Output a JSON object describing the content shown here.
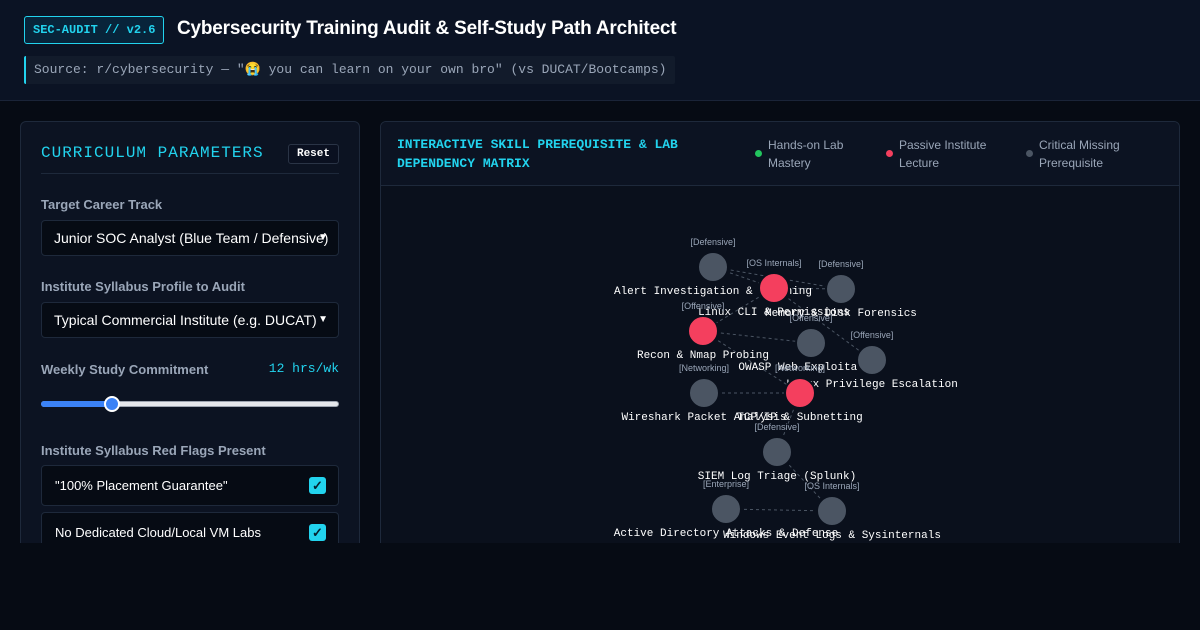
{
  "header": {
    "badge": "SEC-AUDIT // v2.6",
    "title": "Cybersecurity Training Audit & Self-Study Path Architect",
    "source": "Source: r/cybersecurity — \"😭 you can learn on your own bro\" (vs DUCAT/Bootcamps)"
  },
  "params": {
    "title": "CURRICULUM PARAMETERS",
    "reset_label": "Reset",
    "career_label": "Target Career Track",
    "career_value": "Junior SOC Analyst (Blue Team / Defensive)",
    "syllabus_label": "Institute Syllabus Profile to Audit",
    "syllabus_value": "Typical Commercial Institute (e.g. DUCAT)",
    "commitment_label": "Weekly Study Commitment",
    "commitment_value": "12 hrs/wk",
    "commitment_hours": 12,
    "commitment_min": 1,
    "commitment_max": 50,
    "redflags_label": "Institute Syllabus Red Flags Present",
    "flags": [
      {
        "label": "\"100% Placement Guarantee\"",
        "checked": true
      },
      {
        "label": "No Dedicated Cloud/Local VM Labs",
        "checked": true
      }
    ]
  },
  "graph": {
    "title": "INTERACTIVE SKILL PREREQUISITE & LAB DEPENDENCY MATRIX",
    "legend": [
      {
        "label": "Hands-on Lab Mastery",
        "color": "#22c55e"
      },
      {
        "label": "Passive Institute Lecture",
        "color": "#f43f5e"
      },
      {
        "label": "Critical Missing Prerequisite",
        "color": "#4b5563"
      }
    ],
    "nodes": [
      {
        "id": "alert",
        "name": "Alert Investigation & Phishing",
        "category": "[Defensive]",
        "status": "missing"
      },
      {
        "id": "linuxcli",
        "name": "Linux CLI & Permissions",
        "category": "[OS Internals]",
        "status": "lecture"
      },
      {
        "id": "memdisk",
        "name": "Memory & Disk Forensics",
        "category": "[Defensive]",
        "status": "missing"
      },
      {
        "id": "recon",
        "name": "Recon & Nmap Probing",
        "category": "[Offensive]",
        "status": "lecture"
      },
      {
        "id": "owasp",
        "name": "OWASP Web Exploitation",
        "category": "[Offensive]",
        "status": "missing"
      },
      {
        "id": "privesc",
        "name": "Linux Privilege Escalation",
        "category": "[Offensive]",
        "status": "missing"
      },
      {
        "id": "wireshark",
        "name": "Wireshark Packet Analysis",
        "category": "[Networking]",
        "status": "missing"
      },
      {
        "id": "tcpip",
        "name": "TCP/IP & Subnetting",
        "category": "[Networking]",
        "status": "lecture"
      },
      {
        "id": "siem",
        "name": "SIEM Log Triage (Splunk)",
        "category": "[Defensive]",
        "status": "missing"
      },
      {
        "id": "ad",
        "name": "Active Directory Attacks & Defense",
        "category": "[Enterprise]",
        "status": "missing"
      },
      {
        "id": "winlogs",
        "name": "Windows Event Logs & Sysinternals",
        "category": "[OS Internals]",
        "status": "missing"
      }
    ],
    "edges": [
      [
        "alert",
        "linuxcli"
      ],
      [
        "alert",
        "memdisk"
      ],
      [
        "linuxcli",
        "memdisk"
      ],
      [
        "linuxcli",
        "recon"
      ],
      [
        "linuxcli",
        "privesc"
      ],
      [
        "recon",
        "owasp"
      ],
      [
        "recon",
        "tcpip"
      ],
      [
        "wireshark",
        "tcpip"
      ],
      [
        "tcpip",
        "siem"
      ],
      [
        "siem",
        "winlogs"
      ],
      [
        "ad",
        "winlogs"
      ]
    ],
    "status_colors": {
      "lab": "#22c55e",
      "lecture": "#f43f5e",
      "missing": "#4b5563"
    }
  }
}
